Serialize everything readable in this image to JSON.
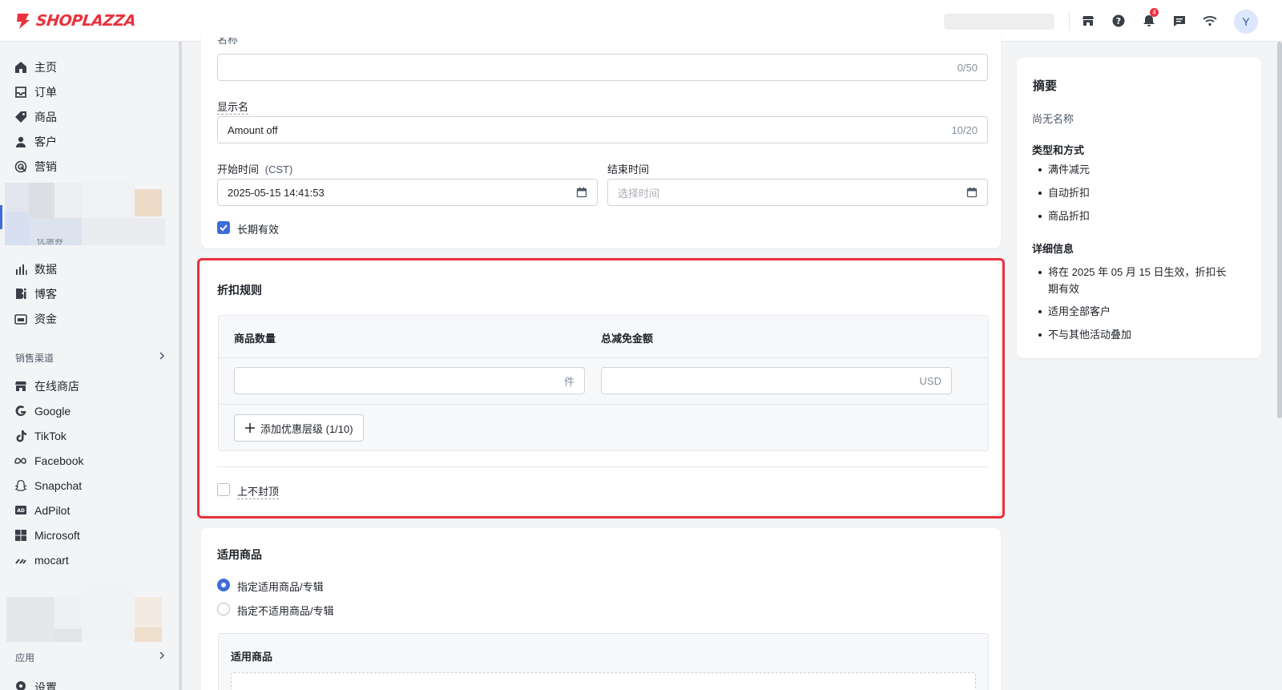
{
  "brand": {
    "name": "SHOPLAZZA",
    "color": "#e8323c"
  },
  "header": {
    "icons": [
      "store-icon",
      "help-icon",
      "bell-icon",
      "chat-icon",
      "wifi-icon"
    ],
    "notification_count": "4",
    "avatar_initial": "Y"
  },
  "sidebar": {
    "items": [
      {
        "label": "主页",
        "icon": "home-icon"
      },
      {
        "label": "订单",
        "icon": "inbox-icon"
      },
      {
        "label": "商品",
        "icon": "tag-icon"
      },
      {
        "label": "客户",
        "icon": "person-icon"
      },
      {
        "label": "营销",
        "icon": "target-icon"
      }
    ],
    "partial_label": "优惠券",
    "items2": [
      {
        "label": "数据",
        "icon": "bar-chart-icon"
      },
      {
        "label": "博客",
        "icon": "blog-icon"
      },
      {
        "label": "资金",
        "icon": "wallet-icon"
      }
    ],
    "channels_title": "销售渠道",
    "channels": [
      {
        "label": "在线商店",
        "icon": "store-icon"
      },
      {
        "label": "Google",
        "icon": "google-icon"
      },
      {
        "label": "TikTok",
        "icon": "tiktok-icon"
      },
      {
        "label": "Facebook",
        "icon": "meta-icon"
      },
      {
        "label": "Snapchat",
        "icon": "snapchat-icon"
      },
      {
        "label": "AdPilot",
        "icon": "ad-icon"
      },
      {
        "label": "Microsoft",
        "icon": "microsoft-icon"
      },
      {
        "label": "mocart",
        "icon": "mocart-icon"
      }
    ],
    "apps_title": "应用",
    "settings_partial": "设置"
  },
  "basic": {
    "name_label": "名称",
    "name_value": "",
    "name_count": "0/50",
    "display_label": "显示名",
    "display_value": "Amount off",
    "display_count": "10/20",
    "start_label": "开始时间",
    "start_tz": "(CST)",
    "start_value": "2025-05-15 14:41:53",
    "end_label": "结束时间",
    "end_placeholder": "选择时间",
    "longterm_label": "长期有效",
    "longterm_checked": true
  },
  "rules": {
    "title": "折扣规则",
    "col_qty": "商品数量",
    "col_amount": "总减免金额",
    "qty_unit": "件",
    "amount_unit": "USD",
    "add_tier": "添加优惠层级 (1/10)",
    "no_cap_label": "上不封顶",
    "no_cap_checked": false
  },
  "products": {
    "title": "适用商品",
    "options": [
      {
        "label": "指定适用商品/专辑",
        "selected": true
      },
      {
        "label": "指定不适用商品/专辑",
        "selected": false
      }
    ],
    "box_title": "适用商品"
  },
  "summary": {
    "title": "摘要",
    "name_status": "尚无名称",
    "type_title": "类型和方式",
    "types": [
      "满件减元",
      "自动折扣",
      "商品折扣"
    ],
    "detail_title": "详细信息",
    "details_1a": "将在 2025 年 05 月 15 日生效，折扣长",
    "details_1b": "期有效",
    "details_2": "适用全部客户",
    "details_3": "不与其他活动叠加"
  },
  "colors": {
    "accent": "#3d6dd8",
    "highlight": "#e8323c"
  }
}
